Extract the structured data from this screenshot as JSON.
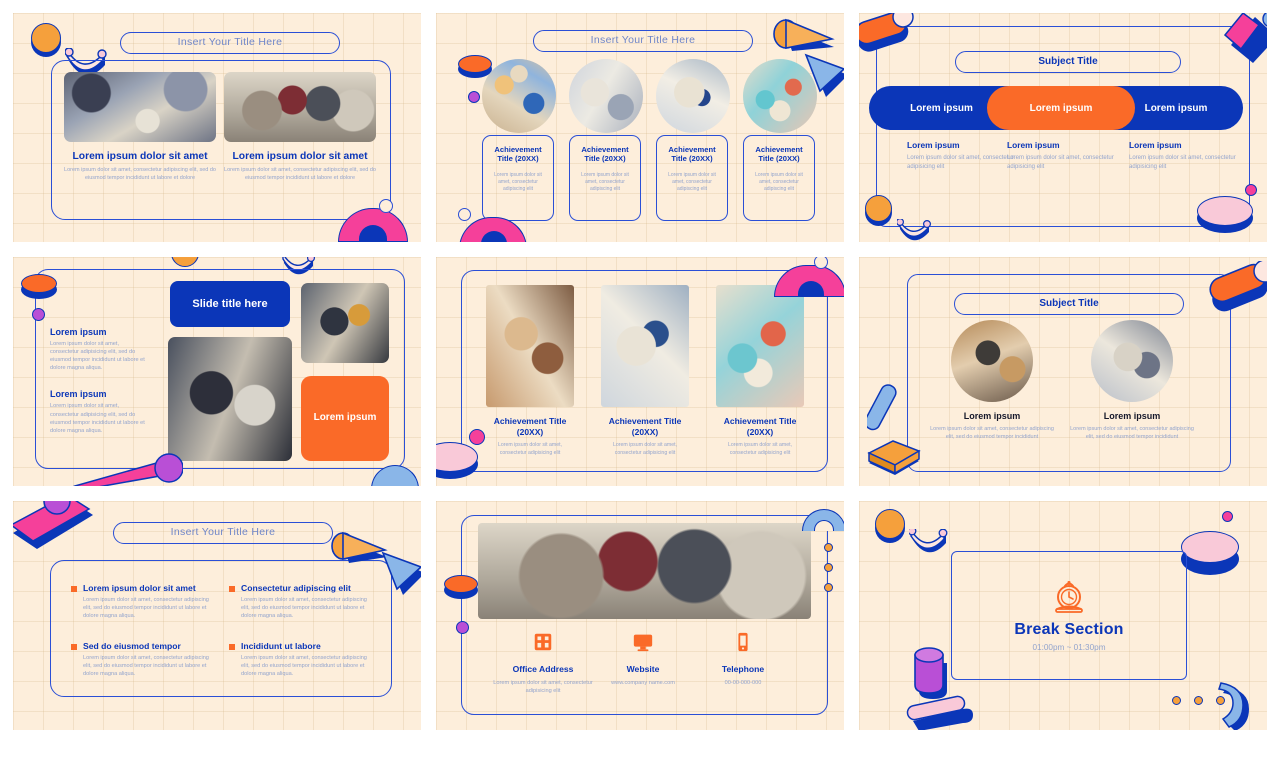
{
  "theme": {
    "blue": "#0b36b8",
    "blue_line": "#2a4fd6",
    "orange": "#fa6a28",
    "amber": "#f5a03c",
    "pink": "#f5409a",
    "purple": "#b94fd6",
    "paper": "#fdeedb",
    "muted_text": "#93a4cd"
  },
  "slides": [
    {
      "id": "slide-1-two-photo-intro",
      "title": "Insert Your Title Here",
      "columns": [
        {
          "heading": "Lorem ipsum dolor sit amet",
          "body": "Lorem ipsum dolor sit amet, consectetur adipiscing elit, sed do eiusmod tempor incididunt ut labore et dolore"
        },
        {
          "heading": "Lorem ipsum dolor sit amet",
          "body": "Lorem ipsum dolor sit amet, consectetur adipiscing elit, sed do eiusmod tempor incididunt ut labore et dolore"
        }
      ]
    },
    {
      "id": "slide-2-four-achievements",
      "title": "Insert Your Title Here",
      "cards": [
        {
          "heading": "Achievement Title (20XX)",
          "body": "Lorem ipsum dolor sit amet, consectetur adipiscing elit"
        },
        {
          "heading": "Achievement Title (20XX)",
          "body": "Lorem ipsum dolor sit amet, consectetur adipiscing elit"
        },
        {
          "heading": "Achievement Title (20XX)",
          "body": "Lorem ipsum dolor sit amet, consectetur adipiscing elit"
        },
        {
          "heading": "Achievement Title (20XX)",
          "body": "Lorem ipsum dolor sit amet, consectetur adipiscing elit"
        }
      ]
    },
    {
      "id": "slide-3-three-step-bar",
      "title": "Subject Title",
      "segments": [
        "Lorem ipsum",
        "Lorem ipsum",
        "Lorem ipsum"
      ],
      "columns": [
        {
          "heading": "Lorem ipsum",
          "body": "Lorem ipsum dolor sit amet, consectetur adipisicing elit"
        },
        {
          "heading": "Lorem ipsum",
          "body": "Lorem ipsum dolor sit amet, consectetur adipisicing elit"
        },
        {
          "heading": "Lorem ipsum",
          "body": "Lorem ipsum dolor sit amet, consectetur adipisicing elit"
        }
      ]
    },
    {
      "id": "slide-4-title-and-gallery",
      "title": "Slide title here",
      "orange_card": "Lorem ipsum",
      "blocks": [
        {
          "heading": "Lorem ipsum",
          "body": "Lorem ipsum dolor sit amet, consectetur adipisicing elit, sed do eiusmod tempor incididunt ut labore et dolore magna aliqua."
        },
        {
          "heading": "Lorem ipsum",
          "body": "Lorem ipsum dolor sit amet, consectetur adipisicing elit, sed do eiusmod tempor incididunt ut labore et dolore magna aliqua."
        }
      ]
    },
    {
      "id": "slide-5-three-achievements",
      "columns": [
        {
          "heading": "Achievement Title (20XX)",
          "body": "Lorem ipsum dolor sit amet, consectetur adipisicing elit"
        },
        {
          "heading": "Achievement Title (20XX)",
          "body": "Lorem ipsum dolor sit amet, consectetur adipisicing elit"
        },
        {
          "heading": "Achievement Title (20XX)",
          "body": "Lorem ipsum dolor sit amet, consectetur adipisicing elit"
        }
      ]
    },
    {
      "id": "slide-6-two-circle-profiles",
      "title": "Subject Title",
      "columns": [
        {
          "heading": "Lorem ipsum",
          "body": "Lorem ipsum dolor sit amet, consectetur adipiscing elit, sed do eiusmod tempor incididunt"
        },
        {
          "heading": "Lorem ipsum",
          "body": "Lorem ipsum dolor sit amet, consectetur adipiscing elit, sed do eiusmod tempor incididunt"
        }
      ]
    },
    {
      "id": "slide-7-four-bullets",
      "title": "Insert Your Title Here",
      "bullets": [
        {
          "heading": "Lorem ipsum dolor sit amet",
          "body": "Lorem ipsum dolor sit amet, consectetur adipiscing elit, sed do eiusmod tempor incididunt ut labore et dolore magna aliqua."
        },
        {
          "heading": "Consectetur adipiscing elit",
          "body": "Lorem ipsum dolor sit amet, consectetur adipiscing elit, sed do eiusmod tempor incididunt ut labore et dolore magna aliqua."
        },
        {
          "heading": "Sed do eiusmod tempor",
          "body": "Lorem ipsum dolor sit amet, consectetur adipiscing elit, sed do eiusmod tempor incididunt ut labore et dolore magna aliqua."
        },
        {
          "heading": "Incididunt ut labore",
          "body": "Lorem ipsum dolor sit amet, consectetur adipiscing elit, sed do eiusmod tempor incididunt ut labore et dolore magna aliqua."
        }
      ]
    },
    {
      "id": "slide-8-contact",
      "contacts": [
        {
          "icon": "office-building-icon",
          "heading": "Office Address",
          "body": "Lorem ipsum dolor sit amet, consectetur adipisicing elit"
        },
        {
          "icon": "monitor-icon",
          "heading": "Website",
          "body": "www.company name.com"
        },
        {
          "icon": "mobile-phone-icon",
          "heading": "Telephone",
          "body": "00-00-000-000"
        }
      ]
    },
    {
      "id": "slide-9-break-section",
      "icon": "alarm-clock-icon",
      "heading": "Break Section",
      "time": "01:00pm ~ 01:30pm"
    }
  ]
}
